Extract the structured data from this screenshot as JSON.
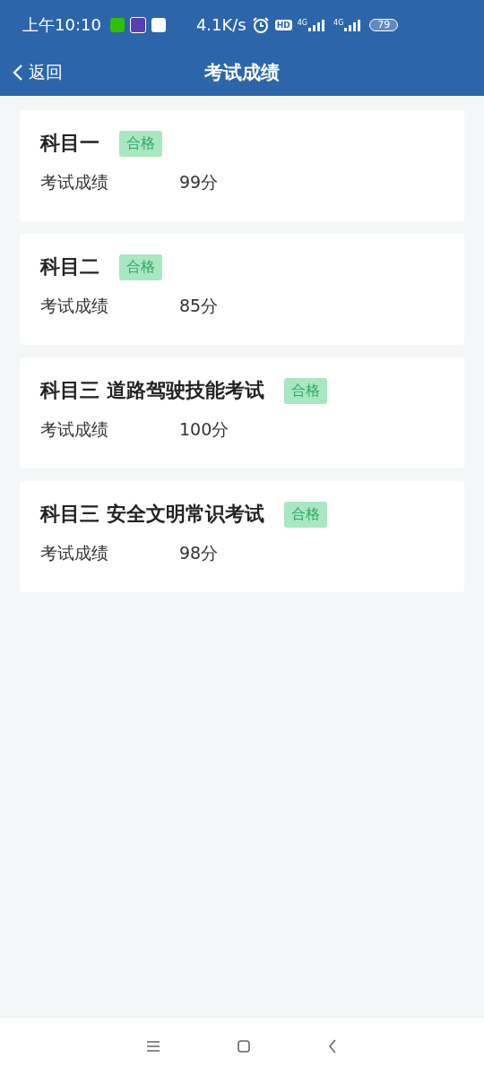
{
  "status_bar": {
    "time": "上午10:10",
    "speed": "4.1K/s",
    "hd": "HD",
    "network_1": "4G",
    "network_2": "4G",
    "battery": "79"
  },
  "nav": {
    "back": "返回",
    "title": "考试成绩"
  },
  "results": [
    {
      "subject": "科目一",
      "badge": "合格",
      "label": "考试成绩",
      "score": "99分"
    },
    {
      "subject": "科目二",
      "badge": "合格",
      "label": "考试成绩",
      "score": "85分"
    },
    {
      "subject": "科目三 道路驾驶技能考试",
      "badge": "合格",
      "label": "考试成绩",
      "score": "100分"
    },
    {
      "subject": "科目三 安全文明常识考试",
      "badge": "合格",
      "label": "考试成绩",
      "score": "98分"
    }
  ]
}
